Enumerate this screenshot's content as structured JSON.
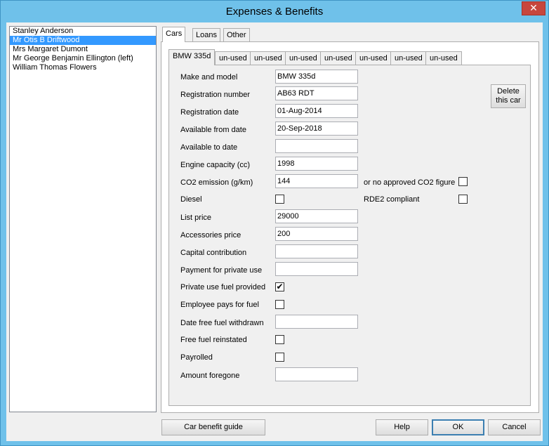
{
  "window": {
    "title": "Expenses & Benefits",
    "close_glyph": "✕"
  },
  "employees": [
    {
      "name": "Stanley Anderson",
      "selected": false
    },
    {
      "name": "Mr Otis B Driftwood",
      "selected": true
    },
    {
      "name": "Mrs Margaret Dumont",
      "selected": false
    },
    {
      "name": "Mr George Benjamin Ellington (left)",
      "selected": false
    },
    {
      "name": "William Thomas Flowers",
      "selected": false
    }
  ],
  "outer_tabs": [
    "Cars",
    "Loans",
    "Other"
  ],
  "car_tabs": [
    "BMW 335d",
    "un-used",
    "un-used",
    "un-used",
    "un-used",
    "un-used",
    "un-used",
    "un-used"
  ],
  "form": {
    "make_model": {
      "label": "Make and model",
      "value": "BMW 335d"
    },
    "registration_number": {
      "label": "Registration number",
      "value": "AB63 RDT"
    },
    "registration_date": {
      "label": "Registration date",
      "value": "01-Aug-2014"
    },
    "available_from": {
      "label": "Available from date",
      "value": "20-Sep-2018"
    },
    "available_to": {
      "label": "Available to date",
      "value": ""
    },
    "engine_capacity": {
      "label": "Engine capacity (cc)",
      "value": "1998"
    },
    "co2_emission": {
      "label": "CO2 emission (g/km)",
      "value": "144"
    },
    "no_co2": {
      "label": "or no approved CO2 figure",
      "checked": false
    },
    "diesel": {
      "label": "Diesel",
      "checked": false
    },
    "rde2": {
      "label": "RDE2 compliant",
      "checked": false
    },
    "list_price": {
      "label": "List price",
      "value": "29000"
    },
    "accessories_price": {
      "label": "Accessories price",
      "value": "200"
    },
    "capital_contribution": {
      "label": "Capital contribution",
      "value": ""
    },
    "payment_private_use": {
      "label": "Payment for private use",
      "value": ""
    },
    "private_fuel": {
      "label": "Private use fuel provided",
      "checked": true
    },
    "employee_pays_fuel": {
      "label": "Employee pays for fuel",
      "checked": false
    },
    "fuel_withdrawn": {
      "label": "Date free fuel withdrawn",
      "value": ""
    },
    "fuel_reinstated": {
      "label": "Free fuel reinstated",
      "checked": false
    },
    "payrolled": {
      "label": "Payrolled",
      "checked": false
    },
    "amount_foregone": {
      "label": "Amount foregone",
      "value": ""
    }
  },
  "delete_button": {
    "line1": "Delete",
    "line2": "this car"
  },
  "buttons": {
    "car_benefit_guide": "Car benefit guide",
    "help": "Help",
    "ok": "OK",
    "cancel": "Cancel"
  },
  "check_glyph": "✔"
}
